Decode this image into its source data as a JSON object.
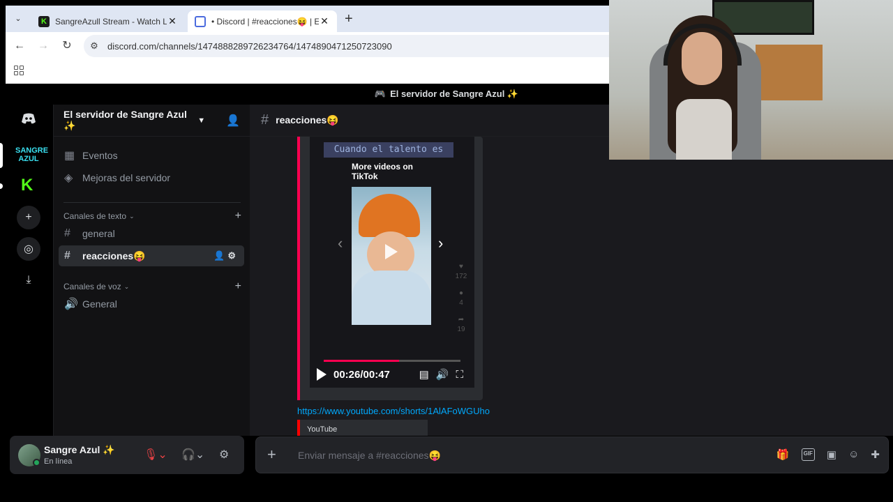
{
  "browser": {
    "tabs": [
      {
        "title": "SangreAzull Stream - Watch Live",
        "active": false
      },
      {
        "title": "• Discord | #reacciones😝 | El s",
        "active": true
      }
    ],
    "url": "discord.com/channels/1474888289726234764/1474890471250723090"
  },
  "discord": {
    "window_title": "El servidor de Sangre Azul ✨",
    "window_icon": "🎮",
    "server_name": "El servidor de Sangre Azul ✨",
    "rail": {
      "server_label": "SANGRE AZUL"
    },
    "sidebar": {
      "events": "Eventos",
      "boosts": "Mejoras del servidor",
      "text_category": "Canales de texto",
      "text_channels": [
        "general",
        "reacciones😝"
      ],
      "voice_category": "Canales de voz",
      "voice_channels": [
        "General"
      ]
    },
    "channel": {
      "name": "reacciones😝"
    },
    "embed": {
      "bg_caption": "Cuando el talento es",
      "more_videos": "More videos on",
      "tiktok": "TikTok",
      "likes": "172",
      "comments": "4",
      "shares": "19",
      "time": "00:26/00:47",
      "progress": 0.55
    },
    "message_link": "https://www.youtube.com/shorts/1AlAFoWGUho",
    "embed2_provider": "YouTube",
    "user": {
      "name": "Sangre Azul ✨",
      "status": "En línea"
    },
    "composer": {
      "placeholder": "Enviar mensaje a #reacciones😝"
    }
  },
  "colors": {
    "accent_link": "#00a8fc",
    "online": "#23a55a",
    "tiktok": "#ff0050"
  }
}
